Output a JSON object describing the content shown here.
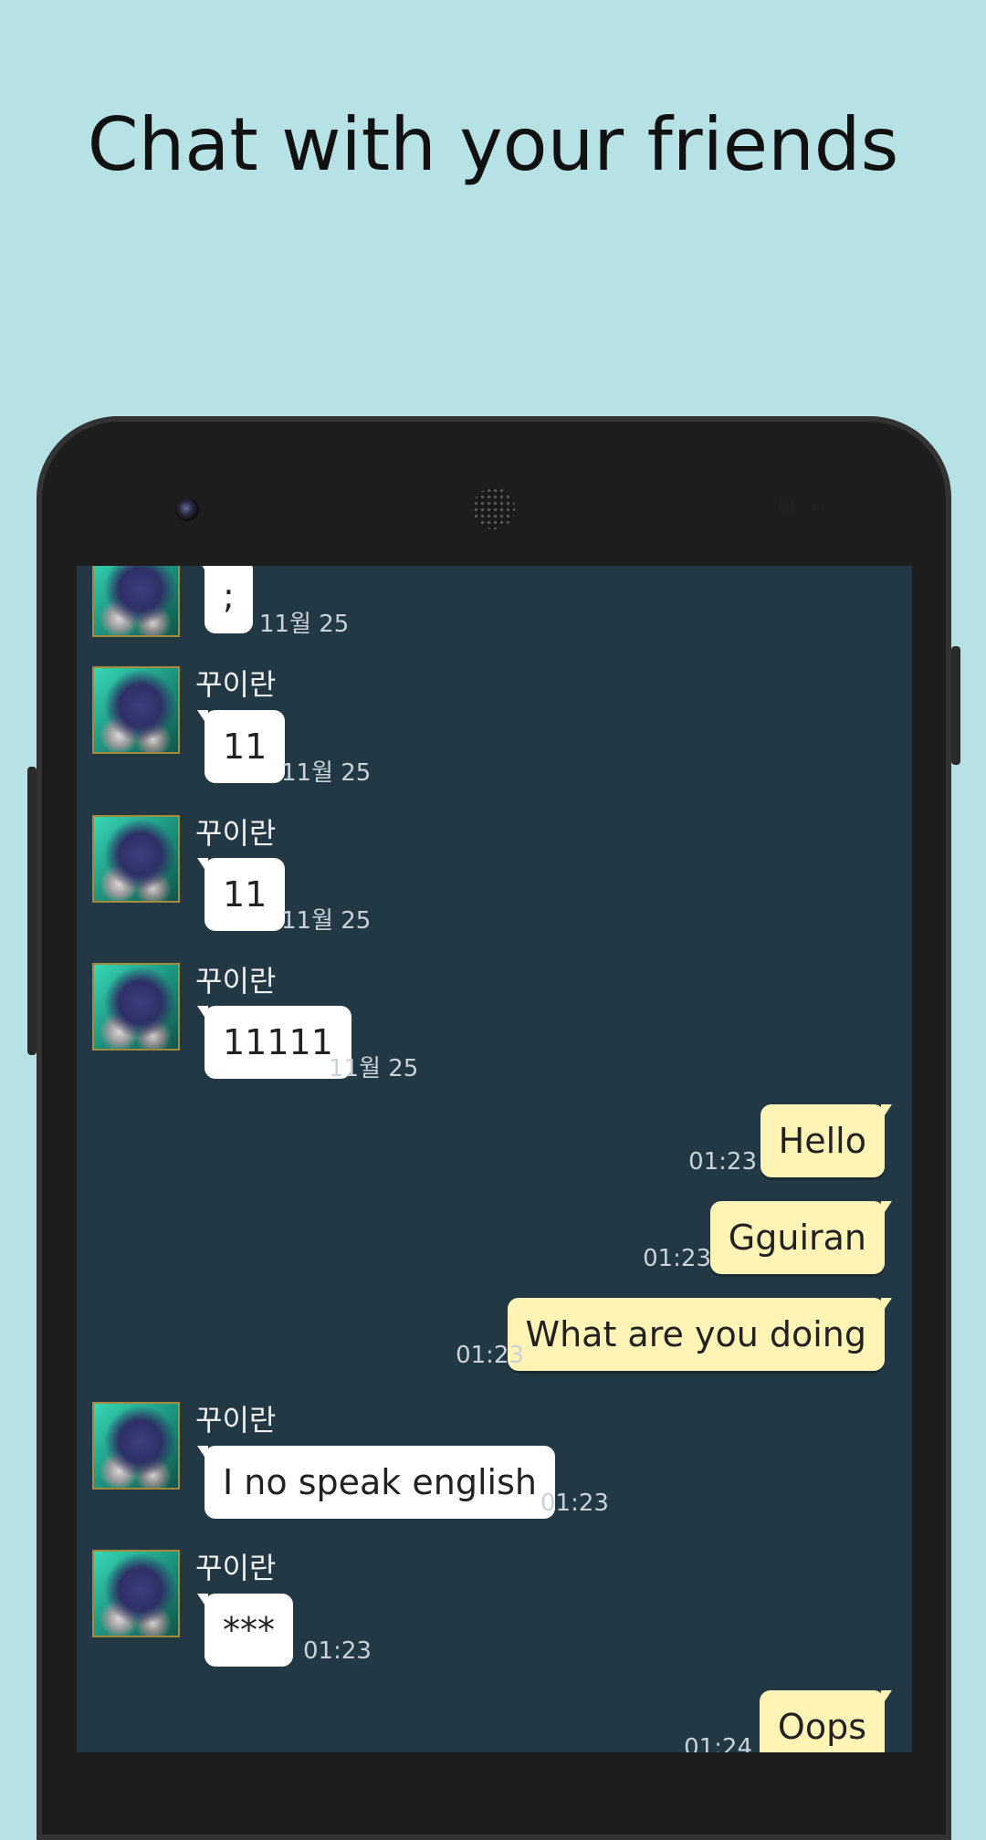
{
  "headline": "Chat with your friends",
  "chat": {
    "contact_name": "꾸이란",
    "messages": [
      {
        "text": ";",
        "time": "11월 25"
      },
      {
        "text": "11",
        "time": "11월 25"
      },
      {
        "text": "11",
        "time": "11월 25"
      },
      {
        "text": "11111",
        "time": "11월 25"
      },
      {
        "text": "Hello",
        "time": "01:23"
      },
      {
        "text": "Gguiran",
        "time": "01:23"
      },
      {
        "text": "What are you doing",
        "time": "01:23"
      },
      {
        "text": "I no speak english",
        "time": "01:23"
      },
      {
        "text": "***",
        "time": "01:23"
      },
      {
        "text": "Oops",
        "time": "01:24"
      }
    ]
  },
  "colors": {
    "page_background": "#b6e2e5",
    "chat_background": "#233845",
    "incoming_bubble": "#ffffff",
    "outgoing_bubble": "#fff3b6"
  }
}
